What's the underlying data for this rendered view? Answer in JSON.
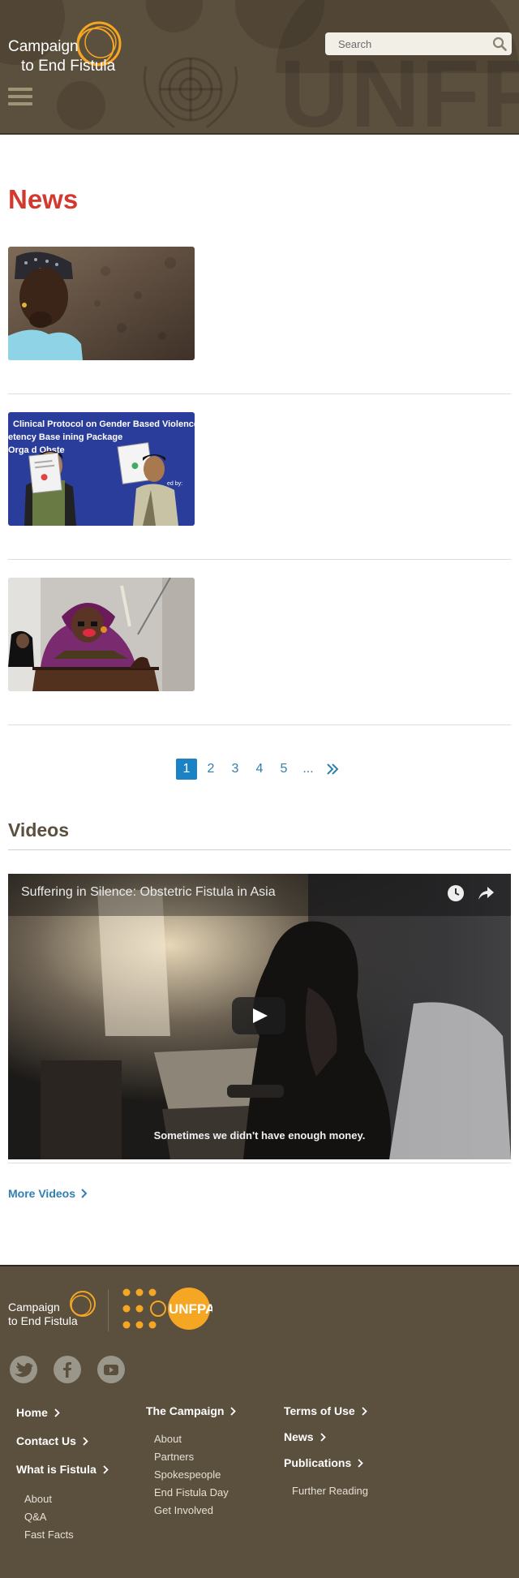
{
  "header": {
    "logo_line1": "Campaign",
    "logo_line2": "to End Fistula",
    "background_text": "UNFPA",
    "search_placeholder": "Search",
    "colors": {
      "header_bg": "#5b4f3d",
      "accent_orange": "#f5a623"
    }
  },
  "news": {
    "title": "News",
    "items": [
      {
        "thumb": "news-photo-girl-portrait"
      },
      {
        "thumb": "news-photo-clinical-protocol-launch",
        "banner_line1": "Clinical Protocol on Gender Based Violence,",
        "banner_line2": "etency Base   ining Package",
        "banner_line3": "Orga        d Obste",
        "banner_line4": "ed by:"
      },
      {
        "thumb": "news-photo-speaker-at-podium"
      }
    ],
    "title_color": "#d23a2f"
  },
  "pagination": {
    "pages": [
      "1",
      "2",
      "3",
      "4",
      "5"
    ],
    "active": "1",
    "ellipsis": "...",
    "next_icon": "double-chevron-right-icon"
  },
  "videos": {
    "title": "Videos",
    "video_title": "Suffering in Silence: Obstetric Fistula in Asia",
    "caption": "Sometimes we didn't have enough money.",
    "more_label": "More Videos"
  },
  "footer": {
    "logo_line1": "Campaign",
    "logo_line2": "to End Fistula",
    "partner_logo": "UNFPA",
    "socials": [
      "twitter-icon",
      "facebook-icon",
      "youtube-icon"
    ],
    "col1": {
      "items": [
        {
          "label": "Home"
        },
        {
          "label": "Contact Us"
        },
        {
          "label": "What is Fistula"
        }
      ],
      "subitems": [
        "About",
        "Q&A",
        "Fast Facts"
      ]
    },
    "col2": {
      "head": "The Campaign",
      "subitems": [
        "About",
        "Partners",
        "Spokespeople",
        "End Fistula Day",
        "Get Involved"
      ]
    },
    "col3": {
      "items": [
        {
          "label": "Terms of Use"
        },
        {
          "label": "News"
        },
        {
          "label": "Publications"
        }
      ],
      "subitems": [
        "Further Reading"
      ]
    }
  }
}
